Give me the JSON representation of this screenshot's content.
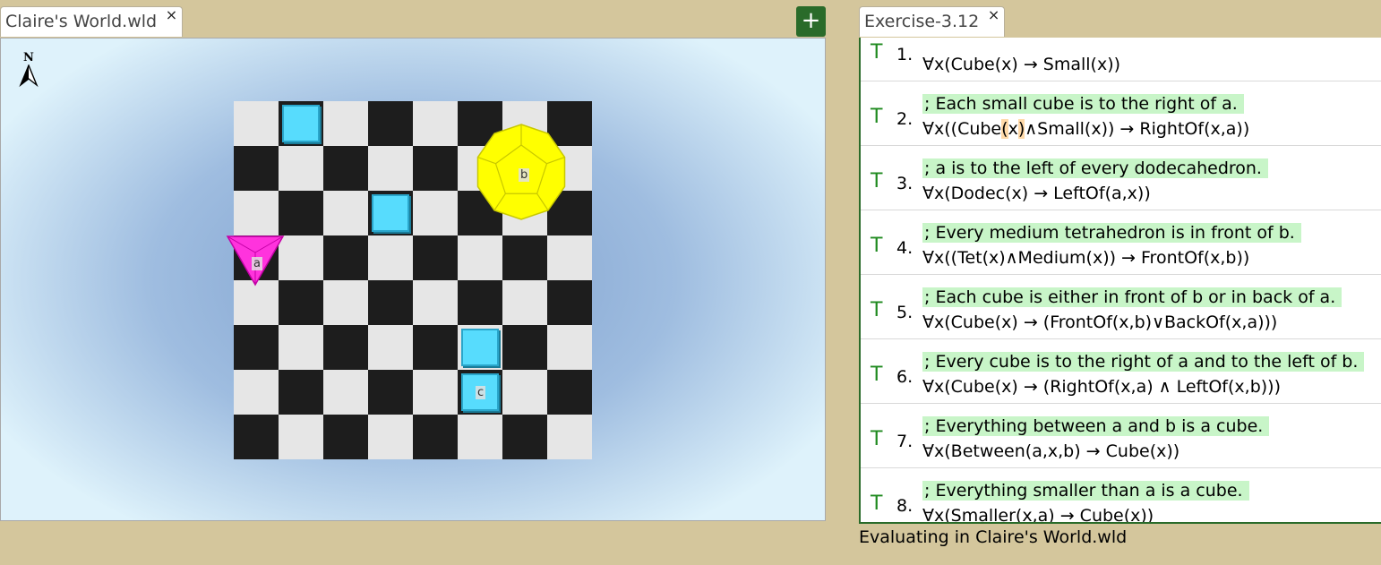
{
  "world_tab": {
    "title": "Claire's World.wld",
    "close": "×"
  },
  "add_button": {
    "label": "+"
  },
  "world": {
    "compass_label": "N",
    "objects": [
      {
        "name": "a",
        "shape": "tetrahedron",
        "color": "magenta",
        "col": 0,
        "row": 3
      },
      {
        "name": "b",
        "shape": "dodecahedron",
        "color": "yellow",
        "col": 6,
        "row": 1
      },
      {
        "name": "c",
        "shape": "cube",
        "color": "cyan",
        "col": 5,
        "row": 6
      },
      {
        "name": "",
        "shape": "cube",
        "color": "cyan",
        "col": 1,
        "row": 0
      },
      {
        "name": "",
        "shape": "cube",
        "color": "cyan",
        "col": 3,
        "row": 2
      },
      {
        "name": "",
        "shape": "cube",
        "color": "cyan",
        "col": 5,
        "row": 5
      }
    ]
  },
  "exercise_tab": {
    "title": "Exercise-3.12",
    "close": "×"
  },
  "sentences": [
    {
      "truth": "T",
      "number": "1.",
      "comment": "",
      "formula": "∀x(Cube(x) → Small(x))"
    },
    {
      "truth": "T",
      "number": "2.",
      "comment": "; Each small cube is to the right of a.",
      "formula_parts": [
        "∀x((Cube",
        "(",
        "x",
        ")",
        "∧Small(x)) → RightOf(x,a))"
      ]
    },
    {
      "truth": "T",
      "number": "3.",
      "comment": "; a is to the left of every dodecahedron.",
      "formula": "∀x(Dodec(x) → LeftOf(a,x))"
    },
    {
      "truth": "T",
      "number": "4.",
      "comment": "; Every medium tetrahedron is in front of b.",
      "formula": "∀x((Tet(x)∧Medium(x)) → FrontOf(x,b))"
    },
    {
      "truth": "T",
      "number": "5.",
      "comment": "; Each cube is either in front of b or in back of a.",
      "formula": "∀x(Cube(x) → (FrontOf(x,b)∨BackOf(x,a)))"
    },
    {
      "truth": "T",
      "number": "6.",
      "comment": "; Every cube is to the right of a and to the left of b.",
      "formula": "∀x(Cube(x) → (RightOf(x,a) ∧ LeftOf(x,b)))"
    },
    {
      "truth": "T",
      "number": "7.",
      "comment": "; Everything between a and b is a cube.",
      "formula": "∀x(Between(a,x,b) → Cube(x))"
    },
    {
      "truth": "T",
      "number": "8.",
      "comment": "; Everything smaller than a is a cube.",
      "formula": "∀x(Smaller(x,a) → Cube(x))"
    }
  ],
  "status": "Evaluating in Claire's World.wld",
  "colors": {
    "accent": "#2a6b2a",
    "background": "#d4c69c",
    "cube": "#57dcfd",
    "dodec": "#ffff00",
    "tet": "#ff33dd",
    "comment_bg": "#c8f5c8"
  }
}
